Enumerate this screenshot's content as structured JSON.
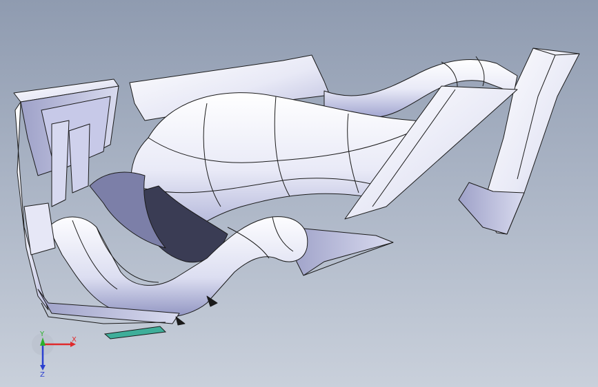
{
  "viewport": {
    "background_top": "#8f9bb0",
    "background_bottom": "#c9d0db",
    "model_fill": "#f2f3fb",
    "model_shade": "#bdbfe0",
    "edge_color": "#1a1a1a",
    "accent_face": "#3fae9a"
  },
  "triad": {
    "x_label": "X",
    "y_label": "Y",
    "z_label": "Z",
    "x_color": "#e0292b",
    "y_color": "#2bb12b",
    "z_color": "#2a3fd0"
  }
}
